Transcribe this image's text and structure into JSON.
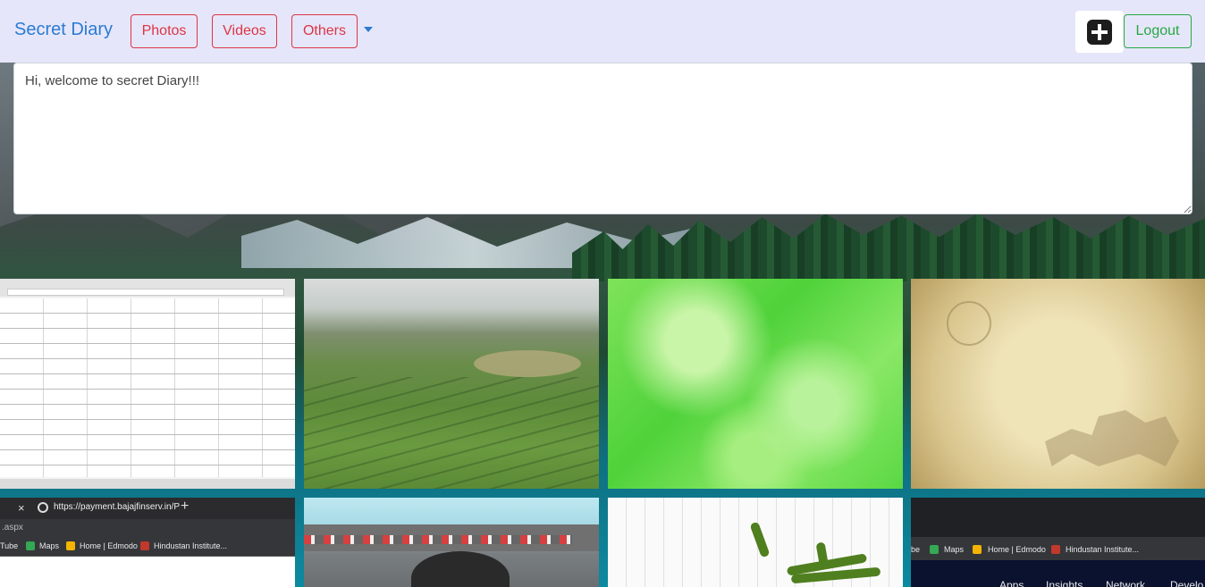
{
  "navbar": {
    "brand": "Secret Diary",
    "buttons": [
      "Photos",
      "Videos",
      "Others"
    ],
    "add_icon": "plus-square-icon",
    "logout": "Logout"
  },
  "diary": {
    "text": "Hi, welcome to secret Diary!!!"
  },
  "gallery": {
    "tile5": {
      "tab_close": "×",
      "url": "https://payment.bajajfinserv.in/P",
      "new_tab": "+",
      "address": ".aspx",
      "bookmarks": [
        "Tube",
        "Maps",
        "Home | Edmodo",
        "Hindustan Institute..."
      ]
    },
    "tile8": {
      "bookmarks": [
        "be",
        "Maps",
        "Home | Edmodo",
        "Hindustan Institute..."
      ],
      "nav_links": [
        "Apps",
        "Insights",
        "Network",
        "Develo"
      ]
    }
  },
  "colors": {
    "navbar_bg": "#e6e6fa",
    "brand": "#2a7bd3",
    "danger": "#dc3545",
    "success": "#28a745"
  }
}
